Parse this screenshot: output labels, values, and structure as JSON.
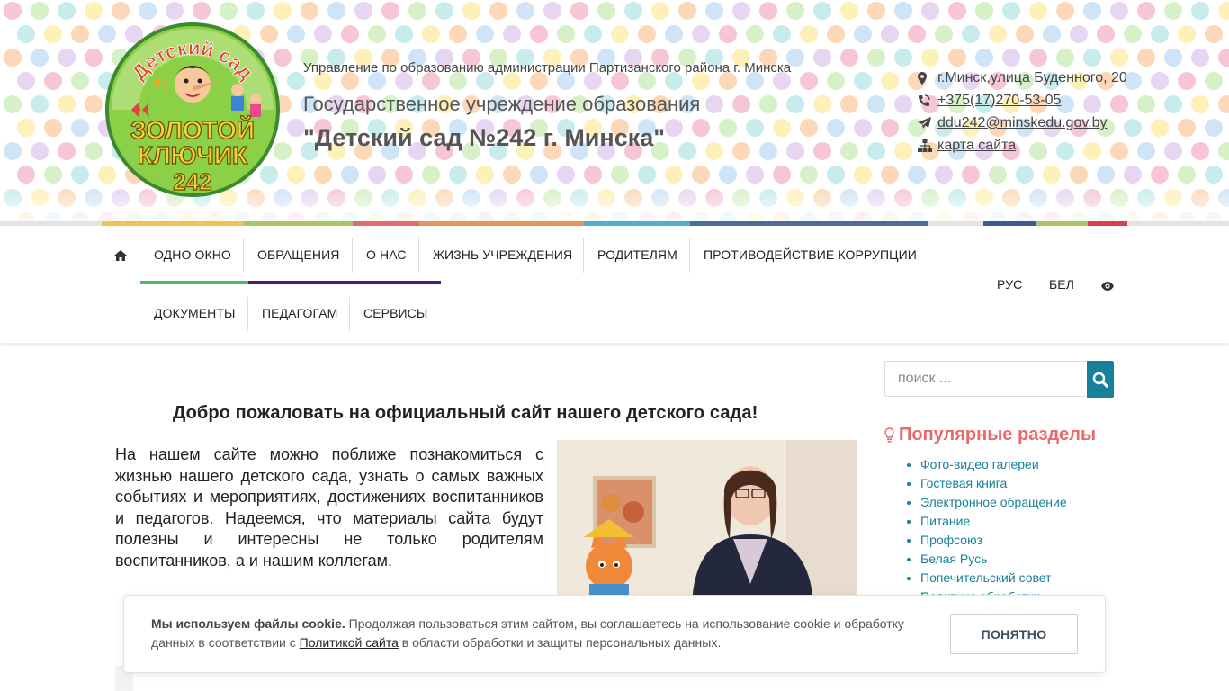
{
  "header": {
    "logo": {
      "arc_text": "Детский сад",
      "line1": "ЗОЛОТОЙ",
      "line2": "КЛЮЧИК",
      "number": "242"
    },
    "org_top": "Управление по образованию администрации Партизанского района г. Минска",
    "org_type": "Государственное учреждение образования",
    "org_name": "\"Детский сад №242 г. Минска\"",
    "contacts": {
      "address": "г.Минск,улица Буденного, 20",
      "phone": "+375(17)270-53-05",
      "email": "ddu242@minskedu.gov.by",
      "sitemap": "карта сайта"
    }
  },
  "nav": {
    "row1": [
      "ОДНО ОКНО",
      "ОБРАЩЕНИЯ",
      "О НАС",
      "ЖИЗНЬ УЧРЕЖДЕНИЯ",
      "РОДИТЕЛЯМ",
      "ПРОТИВОДЕЙСТВИЕ КОРРУПЦИИ"
    ],
    "row2": [
      "ДОКУМЕНТЫ",
      "ПЕДАГОГАМ",
      "СЕРВИСЫ"
    ],
    "lang": [
      "РУС",
      "БЕЛ"
    ]
  },
  "welcome": {
    "title": "Добро пожаловать на официальный сайт нашего детского сада!",
    "text": "На нашем сайте можно поближе познакомиться с жизнью  нашего детского сада, узнать о самых важных событиях и  мероприятиях, достижениях воспитанников и педагогов. Надеемся,  что материалы сайта будут полезны и интересны не только  родителям воспитанников, а и нашим коллегам."
  },
  "sidebar": {
    "search_placeholder": "поиск ...",
    "popular_title": "Популярные разделы",
    "popular_items": [
      "Фото-видео галереи",
      "Гостевая книга",
      "Электронное обращение",
      "Питание",
      "Профсоюз",
      "Белая Русь",
      "Попечительский совет",
      "Политика обработки"
    ]
  },
  "cookie": {
    "bold": "Мы используем файлы cookie.",
    "text1": " Продолжая пользоваться этим сайтом, вы соглашаетесь на использование cookie и обработку данных в соответствии с ",
    "link": "Политикой сайта",
    "text2": " в области обработки и защиты персональных данных.",
    "button": "ПОНЯТНО"
  },
  "colors": {
    "accent_teal": "#168199",
    "popular_red": "#e86a6a",
    "nav_underline_green": "#4cb86a",
    "nav_underline_purple": "#4a1a7a",
    "strip": [
      "#f0c34a",
      "#a8c56a",
      "#e56b6b",
      "#e8955a",
      "#4ab3c9",
      "#4a6e96",
      "#3c5a96",
      "#a8c56a",
      "#d94150"
    ]
  },
  "icons": {
    "home": "home-icon",
    "address": "map-marker-icon",
    "phone": "phone-icon",
    "email": "paper-plane-icon",
    "sitemap": "sitemap-icon",
    "accessibility": "eye-icon",
    "search": "search-icon",
    "popular": "lightbulb-icon"
  }
}
